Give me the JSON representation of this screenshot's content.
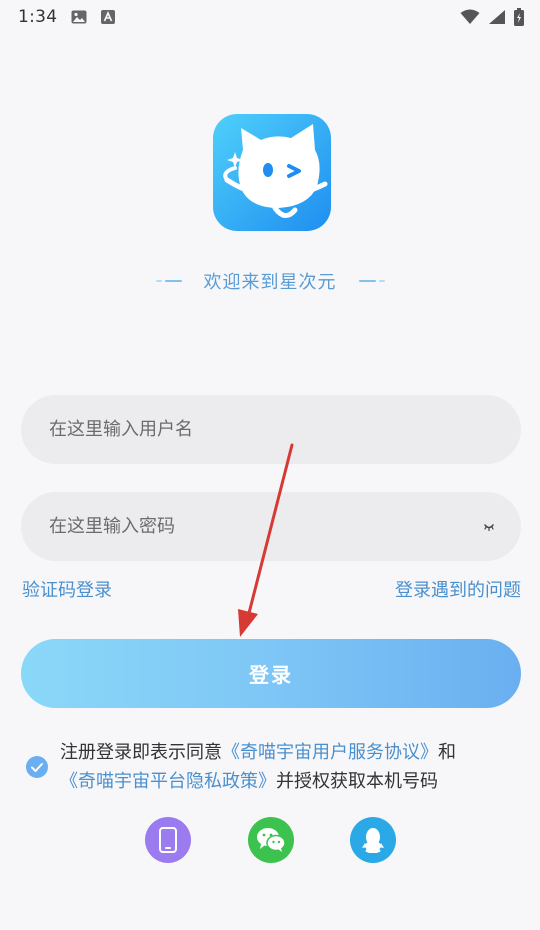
{
  "status_bar": {
    "time": "1:34"
  },
  "welcome": {
    "text": "欢迎来到星次元"
  },
  "form": {
    "username_placeholder": "在这里输入用户名",
    "password_placeholder": "在这里输入密码",
    "sms_login_link": "验证码登录",
    "problem_link": "登录遇到的问题",
    "login_button": "登录"
  },
  "agreement": {
    "checked": true,
    "prefix": "注册登录即表示同意",
    "service_link": "《奇喵宇宙用户服务协议》",
    "middle": "和",
    "privacy_link": "《奇喵宇宙平台隐私政策》",
    "suffix": "并授权获取本机号码"
  },
  "social_login": {
    "phone_color": "#9b7cf0",
    "wechat_color": "#3cc24e",
    "qq_color": "#2aa9e6"
  },
  "colors": {
    "accent": "#4a90cf",
    "button_start": "#8ad8f8",
    "button_end": "#6aaff0",
    "arrow": "#d63a34"
  }
}
